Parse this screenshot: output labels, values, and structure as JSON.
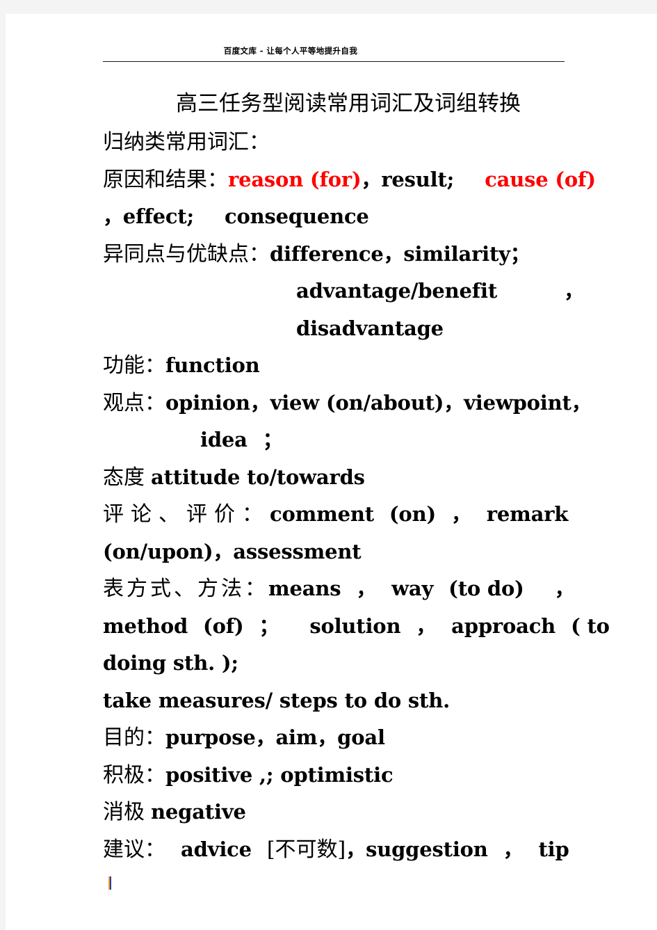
{
  "page": {
    "background_color": "#ffffff",
    "surround_color": "#f4f4f4",
    "accent_red": "#ff0000",
    "text_color": "#000000"
  },
  "header": {
    "watermark": "百度文库 - 让每个人平等地提升自我",
    "rule": "horizontal-rule"
  },
  "document": {
    "title": "高三任务型阅读常用词汇及词组转换",
    "section_heading": "归纳类常用词汇："
  },
  "entries": {
    "cause_effect": {
      "label": "原因和结果：",
      "t1_red": "reason  (for)",
      "t2": "，",
      "t3": "result;",
      "t4_red": "cause (of)",
      "t5": "，effect;",
      "t6": "consequence"
    },
    "compare": {
      "label": "异同点与优缺点：",
      "terms": "difference，similarity；",
      "line2": "advantage/benefit",
      "line2_tail": "，",
      "line3": "disadvantage"
    },
    "function": {
      "label": "功能：",
      "terms": "function"
    },
    "opinion": {
      "label": "观点：",
      "terms": "opinion，view (on/about)，viewpoint，",
      "line2": "idea",
      "line2_tail": "；"
    },
    "attitude": {
      "label": "态度",
      "terms": "attitude  to/towards"
    },
    "comment": {
      "label": "评论、评价：",
      "t1": "comment",
      "t2": "(on)",
      "t3": "，",
      "t4": "remark",
      "line2": "(on/upon)，assessment"
    },
    "means": {
      "label": "表方式、方法：",
      "t1": "means",
      "t2": "，",
      "t3": "way",
      "t4": "(to  do)",
      "t5": "，",
      "line2_a": "method",
      "line2_b": "(of)",
      "line2_c": "；",
      "line2_d": "solution",
      "line2_e": "，",
      "line2_f": "approach",
      "line2_g": "(  to",
      "line3": "doing sth. );",
      "line4": "take  measures/  steps  to  do  sth."
    },
    "purpose": {
      "label": "目的：",
      "terms": "purpose，aim，goal"
    },
    "positive": {
      "label": "积极：",
      "terms": "positive ,; optimistic"
    },
    "negative": {
      "label": "消极",
      "terms": "negative"
    },
    "advice": {
      "label": "建议：",
      "t1": "advice",
      "t2_cn": "[不可数]",
      "t3": "，",
      "t4": "suggestion",
      "t5": "，",
      "t6": "tip"
    }
  },
  "footer": {
    "caret_marker": "text-caret"
  }
}
